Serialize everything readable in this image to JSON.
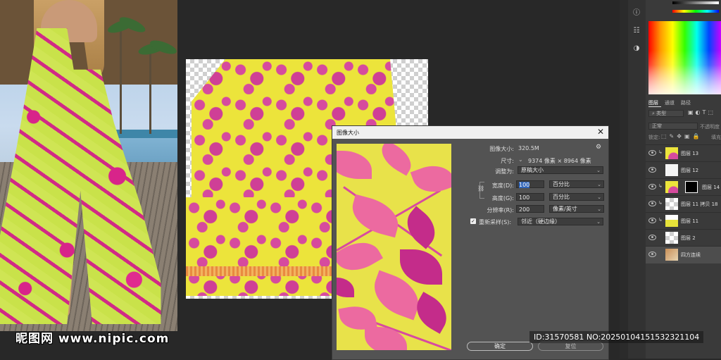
{
  "dialog": {
    "title": "图像大小",
    "close_glyph": "✕",
    "image_size_label": "图像大小:",
    "image_size_value": "320.5M",
    "dimensions_label": "尺寸:",
    "dimensions_value": "9374 像素 × 8964 像素",
    "fit_to_label": "调整为:",
    "fit_to_value": "原稿大小",
    "width_label": "宽度(D):",
    "width_value": "100",
    "width_unit": "百分比",
    "height_label": "高度(G):",
    "height_value": "100",
    "height_unit": "百分比",
    "resolution_label": "分辨率(R):",
    "resolution_value": "200",
    "resolution_unit": "像素/英寸",
    "resample_label": "重新采样(S):",
    "resample_checked": true,
    "resample_value": "邻近（硬边缘）",
    "ok_label": "确定",
    "reset_label": "复位"
  },
  "panels": {
    "tabs": [
      "图层",
      "通道",
      "路径"
    ],
    "active_tab": "图层",
    "filter_placeholder": "类型",
    "blend_mode": "正常",
    "opacity_label": "不透明度",
    "lock_label": "锁定:",
    "fill_label": "填充",
    "layers": [
      {
        "name": "图层 13",
        "clipped": true,
        "thumb": "pattern",
        "mask": false,
        "selected": false
      },
      {
        "name": "图层 12",
        "clipped": false,
        "thumb": "white",
        "mask": false,
        "selected": false
      },
      {
        "name": "图层 14",
        "clipped": true,
        "thumb": "pattern",
        "mask": true,
        "selected": false
      },
      {
        "name": "图层 11 拷贝 18",
        "clipped": true,
        "thumb": "checker",
        "mask": false,
        "selected": false
      },
      {
        "name": "图层 11",
        "clipped": true,
        "thumb": "yellow",
        "mask": false,
        "selected": false
      },
      {
        "name": "图层 2",
        "clipped": false,
        "thumb": "checker",
        "mask": false,
        "selected": false
      },
      {
        "name": "四方连续",
        "clipped": false,
        "thumb": "photo",
        "mask": false,
        "selected": true
      }
    ]
  },
  "watermark": {
    "site_logo": "昵图网",
    "site_url": "www.nipic.com",
    "image_id": "ID:31570581 NO:20250104151532321104"
  },
  "colors": {
    "accent_highlight": "#2f64b8",
    "fabric_yellow": "#ece43b",
    "fabric_pink": "#d64a9e",
    "dress_green": "#c9e24a",
    "dress_magenta": "#d8248a"
  }
}
